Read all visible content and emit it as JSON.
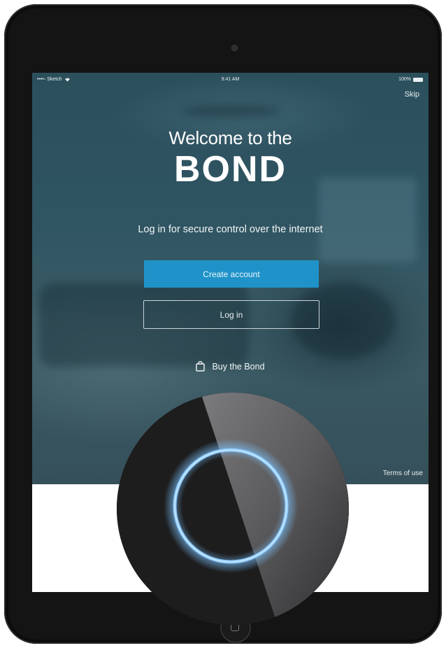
{
  "status_bar": {
    "carrier": "••••◦ Sketch",
    "time": "9:41 AM",
    "battery": "100%"
  },
  "header": {
    "skip_label": "Skip"
  },
  "welcome": {
    "line1": "Welcome to the",
    "brand": "BOND",
    "tagline": "Log in for secure control over the internet"
  },
  "actions": {
    "create_account_label": "Create account",
    "login_label": "Log in",
    "buy_label": "Buy the Bond"
  },
  "footer": {
    "terms_label": "Terms of use"
  },
  "colors": {
    "primary_button": "#1f93c9",
    "hero_background": "#2f5462",
    "ring_glow": "#7cc4ff"
  },
  "icons": {
    "buy": "shopping-bag-icon",
    "wifi": "wifi-icon",
    "battery": "battery-icon"
  }
}
